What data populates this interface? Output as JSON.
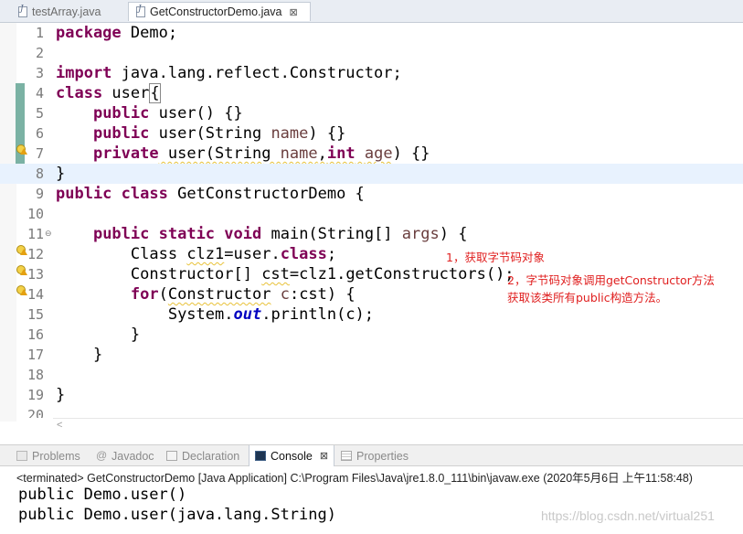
{
  "editor_tabs": [
    {
      "label": "testArray.java",
      "active": false
    },
    {
      "label": "GetConstructorDemo.java",
      "active": true,
      "close": "⊠"
    }
  ],
  "lines": [
    {
      "num": "1"
    },
    {
      "num": "2"
    },
    {
      "num": "3"
    },
    {
      "num": "4"
    },
    {
      "num": "5"
    },
    {
      "num": "6"
    },
    {
      "num": "7"
    },
    {
      "num": "8"
    },
    {
      "num": "9"
    },
    {
      "num": "10"
    },
    {
      "num": "11"
    },
    {
      "num": "12"
    },
    {
      "num": "13"
    },
    {
      "num": "14"
    },
    {
      "num": "15"
    },
    {
      "num": "16"
    },
    {
      "num": "17"
    },
    {
      "num": "18"
    },
    {
      "num": "19"
    },
    {
      "num": "20"
    }
  ],
  "code": {
    "l1": {
      "kw": "package",
      "rest": " Demo;"
    },
    "l3": {
      "kw": "import",
      "rest": " java.lang.reflect.Constructor;"
    },
    "l4": {
      "kw": "class",
      "name": " user",
      "brace": "{"
    },
    "l5": {
      "indent": "    ",
      "kw": "public",
      "rest": " user() {}"
    },
    "l6": {
      "indent": "    ",
      "kw": "public",
      "a": " user(String ",
      "p": "name",
      "b": ") {}"
    },
    "l7": {
      "indent": "    ",
      "kw": "private",
      "a": " user(String ",
      "p1": "name",
      "c": ",",
      "kw2": "int",
      "sp": " ",
      "p2": "age",
      "b": ") {}"
    },
    "l8": {
      "rest": "}"
    },
    "l9": {
      "kw": "public",
      "kw2": "class",
      "rest": " GetConstructorDemo {"
    },
    "l11": {
      "indent": "    ",
      "kw": "public",
      "kw2": "static",
      "kw3": "void",
      "a": " main(String[] ",
      "p": "args",
      "b": ") {"
    },
    "l12": {
      "indent": "        ",
      "a": "Class ",
      "w": "clz1",
      "b": "=user.",
      "kw": "class",
      "c": ";"
    },
    "l13": {
      "indent": "        ",
      "a": "Constructor[] ",
      "w": "cst",
      "b": "=clz1.getConstructors();"
    },
    "l14": {
      "indent": "        ",
      "kw": "for",
      "a": "(",
      "w": "Constructor",
      "sp": " ",
      "p": "c",
      "b": ":cst) {"
    },
    "l15": {
      "indent": "            ",
      "a": "System.",
      "f": "out",
      "b": ".println(c);"
    },
    "l16": {
      "indent": "        ",
      "rest": "}"
    },
    "l17": {
      "indent": "    ",
      "rest": "}"
    },
    "l19": {
      "rest": "}"
    }
  },
  "annotations": {
    "a1": "1，获取字节码对象",
    "a2": "2，字节码对象调用getConstructor方法",
    "a3": "获取该类所有public构造方法。"
  },
  "view_tabs": [
    {
      "label": "Problems"
    },
    {
      "label": "Javadoc",
      "icon": "@"
    },
    {
      "label": "Declaration"
    },
    {
      "label": "Console",
      "close": "⊠"
    },
    {
      "label": "Properties"
    }
  ],
  "console": {
    "status": "<terminated> GetConstructorDemo [Java Application] C:\\Program Files\\Java\\jre1.8.0_111\\bin\\javaw.exe (2020年5月6日 上午11:58:48)",
    "output": [
      "public Demo.user()",
      "public Demo.user(java.lang.String)"
    ],
    "watermark": "https://blog.csdn.net/virtual251"
  },
  "colors": {
    "keyword": "#7f0055",
    "parameter": "#6a3e3e",
    "static_field": "#0000c0",
    "annotation": "#e02020",
    "change_bar": "#7bb2a4",
    "current_line": "#e8f2fe"
  },
  "scroll_arrow": "<"
}
